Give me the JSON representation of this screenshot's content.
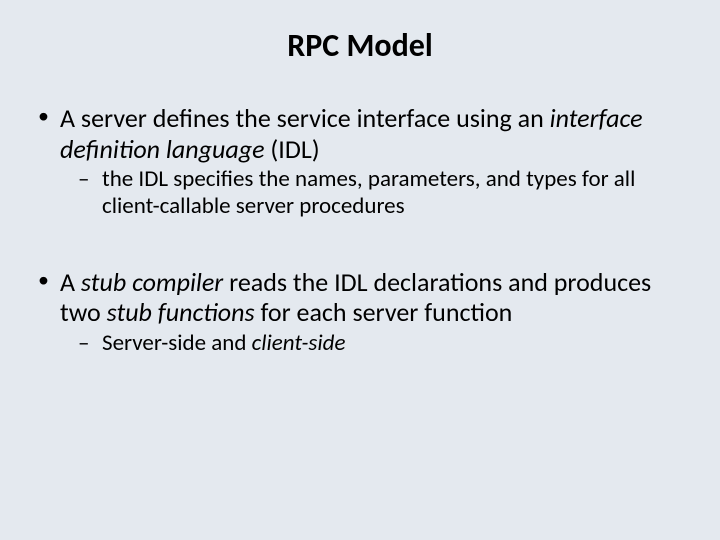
{
  "title": "RPC Model",
  "bullets": [
    {
      "pre1": "A server defines the service interface using an ",
      "em1": "interface definition language",
      "post1": " (IDL)",
      "sub": [
        {
          "text": "the IDL specifies the names, parameters, and types for all client-callable server procedures"
        }
      ]
    },
    {
      "pre1": "A ",
      "em1": "stub compiler",
      "mid1": " reads the IDL declarations and produces two ",
      "em2": "stub functions",
      "post1": " for each server function",
      "sub": [
        {
          "pre": "Server-side",
          "mid": " and ",
          "em": "client-side"
        }
      ]
    }
  ]
}
